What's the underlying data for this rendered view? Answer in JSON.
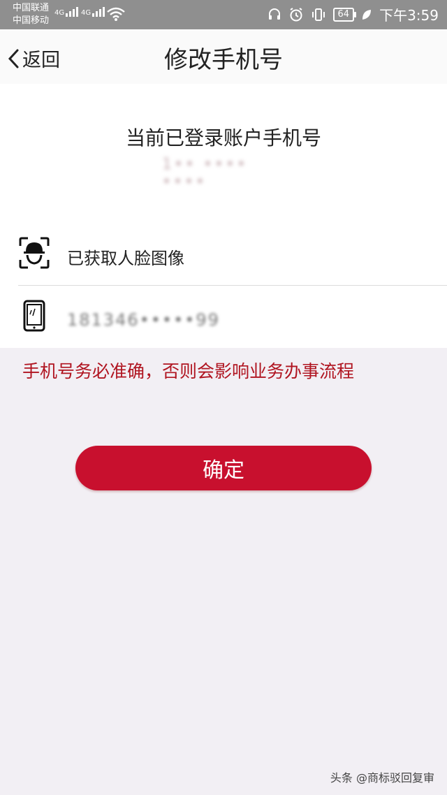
{
  "status_bar": {
    "carrier_1": "中国联通",
    "carrier_2": "中国移动",
    "network_1": "4G",
    "network_2": "4G",
    "battery": "64",
    "time": "下午3:59",
    "icons": [
      "headset-icon",
      "alarm-icon",
      "vibrate-icon",
      "battery-icon",
      "leaf-icon",
      "wifi-icon",
      "signal-icon"
    ]
  },
  "nav": {
    "back_label": "返回",
    "title": "修改手机号"
  },
  "account": {
    "label": "当前已登录账户手机号",
    "phone_masked": "1•• •••• ••••"
  },
  "rows": {
    "face": {
      "icon": "face-scan-icon",
      "text": "已获取人脸图像"
    },
    "phone": {
      "icon": "mobile-phone-icon",
      "value": "181346•••••99"
    }
  },
  "warning": "手机号务必准确，否则会影响业务办事流程",
  "confirm_label": "确定",
  "watermark": "头条 @商标驳回复审",
  "colors": {
    "accent": "#c8102e",
    "warning": "#b01420",
    "page_bg": "#f2eff4",
    "statusbar": "#8f8f8f"
  }
}
